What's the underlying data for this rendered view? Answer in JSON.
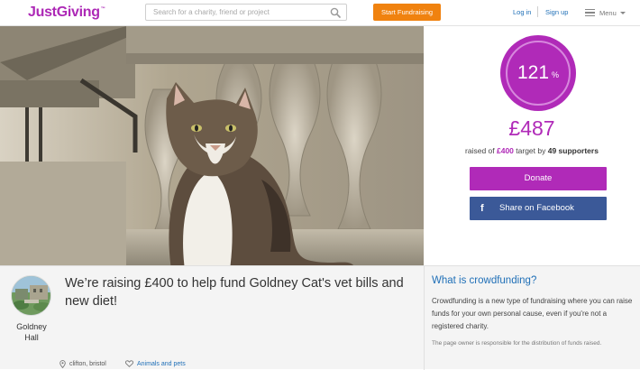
{
  "header": {
    "logo": "JustGiving",
    "logo_tm": "™",
    "search_placeholder": "Search for a charity, friend or project",
    "start_button": "Start Fundraising",
    "login": "Log in",
    "signup": "Sign up",
    "menu": "Menu"
  },
  "hero": {
    "image_icon": "photo-of-cat"
  },
  "stats": {
    "percent": "121",
    "percent_sign": "%",
    "progress_fraction": 1.21,
    "raised": "£487",
    "target_prefix": "raised of ",
    "target_amount": "£400",
    "target_mid": " target by ",
    "supporters": "49 supporters",
    "donate": "Donate",
    "share": "Share on Facebook"
  },
  "page": {
    "owner_name": "Goldney Hall",
    "title": "We’re raising £400 to help fund Goldney Cat's vet bills and new diet!",
    "location": "clifton, bristol",
    "category": "Animals and pets"
  },
  "crowdfunding": {
    "title": "What is crowdfunding?",
    "text": "Crowdfunding is a new type of fundraising where you can raise funds for your own personal cause, even if you're not a registered charity.",
    "note": "The page owner is responsible for the distribution of funds raised."
  },
  "colors": {
    "brand_purple": "#b02ab8",
    "orange": "#f0820f",
    "facebook": "#3b5998",
    "link_blue": "#1f6fb7"
  }
}
